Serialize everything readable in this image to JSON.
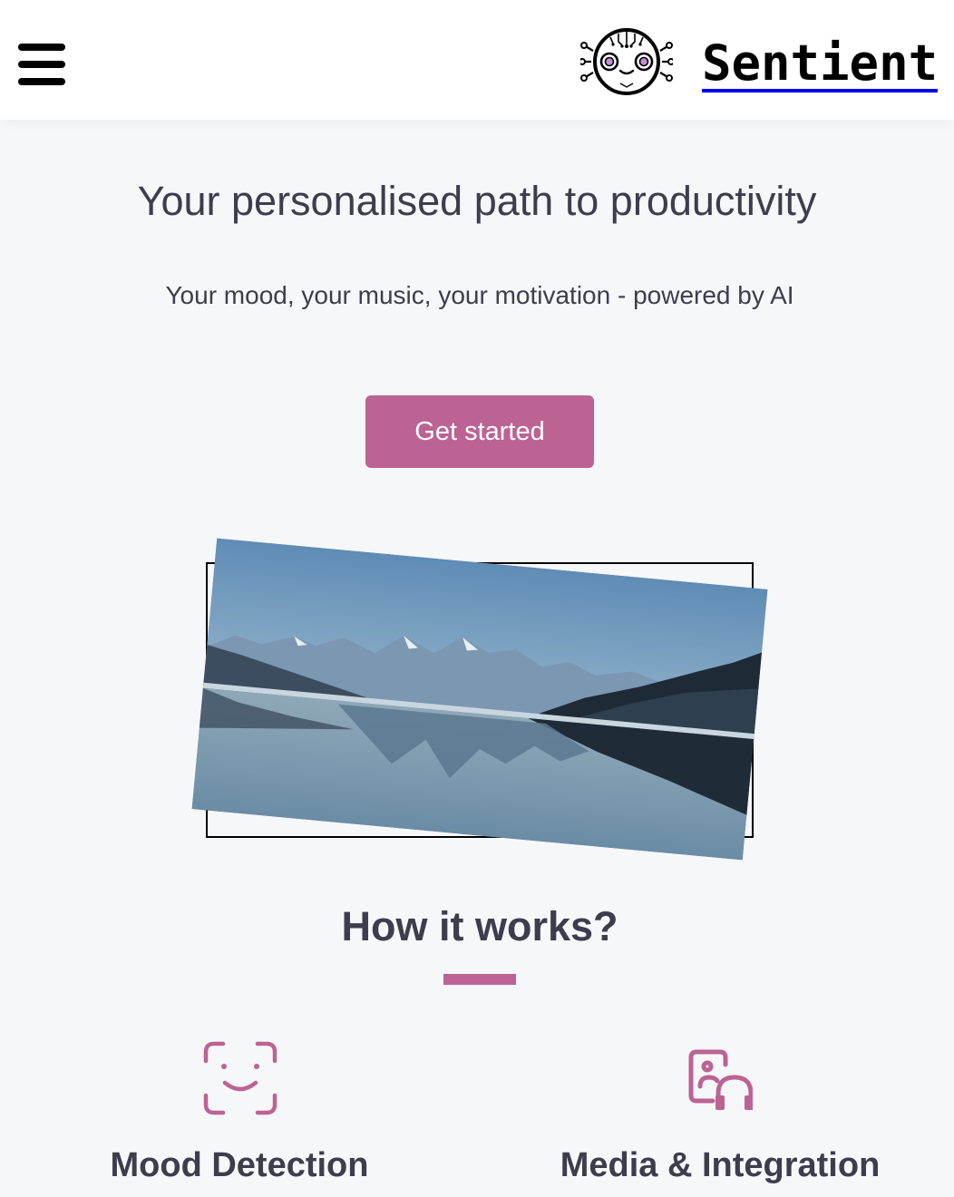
{
  "header": {
    "menu_icon": "hamburger-menu-icon",
    "logo_icon": "robot-face-logo-icon",
    "brand": "Sentient"
  },
  "hero": {
    "title": "Your personalised path to productivity",
    "subtitle": "Your mood, your music, your motivation - powered by AI",
    "cta_label": "Get started",
    "image_icon": "mountain-lake-photo"
  },
  "how_it_works": {
    "title": "How it works?",
    "features": [
      {
        "icon": "face-scan-icon",
        "title": "Mood Detection"
      },
      {
        "icon": "media-headphones-icon",
        "title": "Media & Integration"
      }
    ]
  },
  "colors": {
    "accent": "#bc6394",
    "text": "#3d3d4e",
    "background": "#f6f7f9"
  }
}
